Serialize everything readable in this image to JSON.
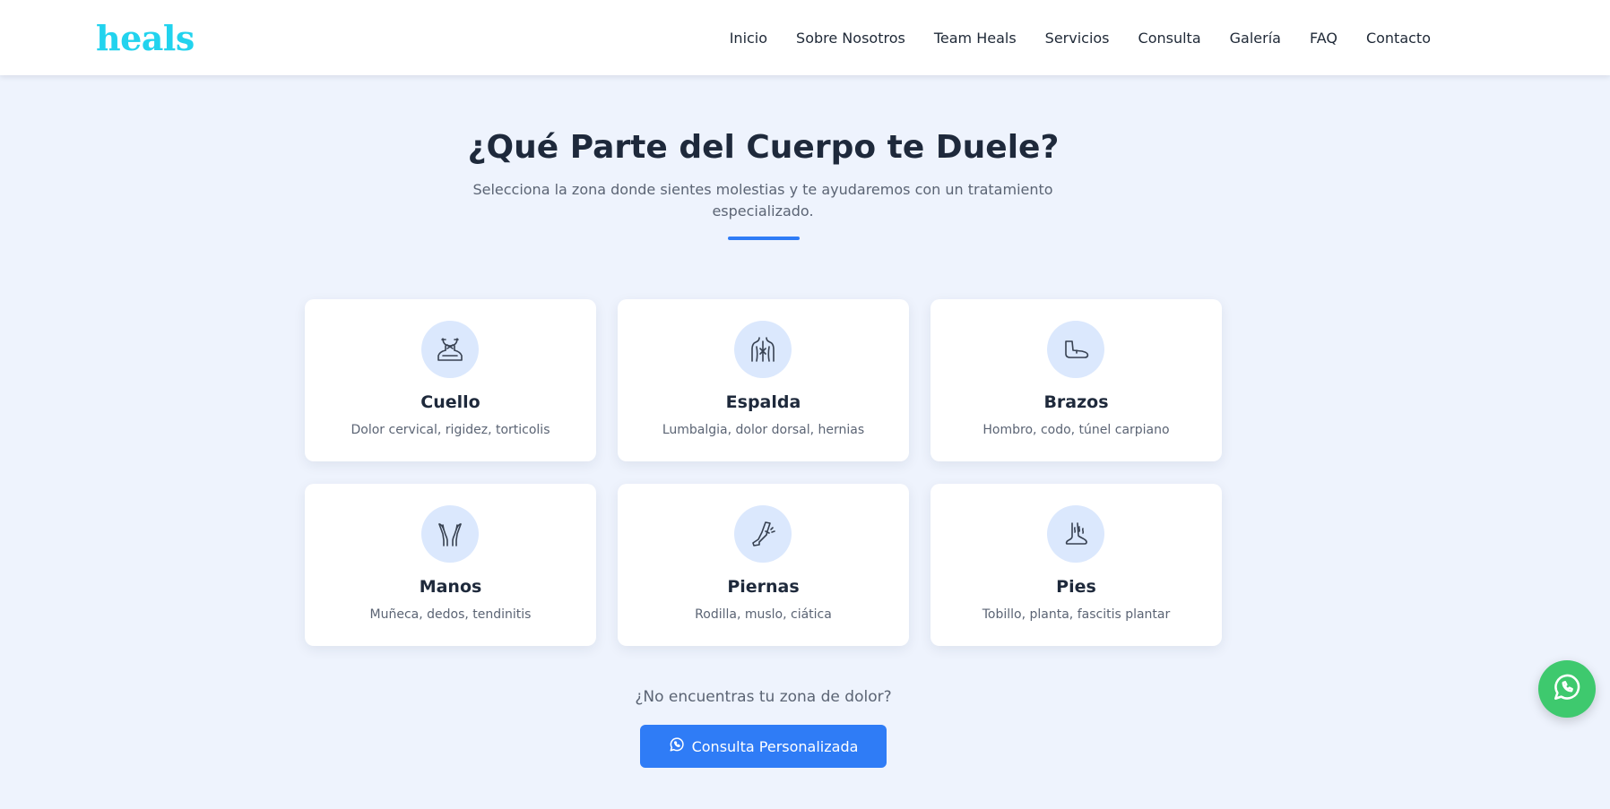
{
  "brand": {
    "logo_text": "heals",
    "logo_color": "#22d3ee",
    "accent_color": "#2f7cf6"
  },
  "nav": {
    "items": [
      "Inicio",
      "Sobre Nosotros",
      "Team Heals",
      "Servicios",
      "Consulta",
      "Galería",
      "FAQ",
      "Contacto"
    ]
  },
  "section": {
    "title": "¿Qué Parte del Cuerpo te Duele?",
    "subtitle": "Selecciona la zona donde sientes molestias y te ayudaremos con un tratamiento especializado."
  },
  "cards": [
    {
      "title": "Cuello",
      "desc": "Dolor cervical, rigidez, torticolis",
      "icon": "neck-icon"
    },
    {
      "title": "Espalda",
      "desc": "Lumbalgia, dolor dorsal, hernias",
      "icon": "back-icon"
    },
    {
      "title": "Brazos",
      "desc": "Hombro, codo, túnel carpiano",
      "icon": "arm-icon"
    },
    {
      "title": "Manos",
      "desc": "Muñeca, dedos, tendinitis",
      "icon": "hands-icon"
    },
    {
      "title": "Piernas",
      "desc": "Rodilla, muslo, ciática",
      "icon": "leg-icon"
    },
    {
      "title": "Pies",
      "desc": "Tobillo, planta, fascitis plantar",
      "icon": "foot-icon"
    }
  ],
  "cta": {
    "question": "¿No encuentras tu zona de dolor?",
    "button_label": "Consulta Personalizada",
    "button_icon": "whatsapp-icon"
  },
  "floating_button": {
    "icon": "whatsapp-icon",
    "color": "#3ec96e"
  }
}
